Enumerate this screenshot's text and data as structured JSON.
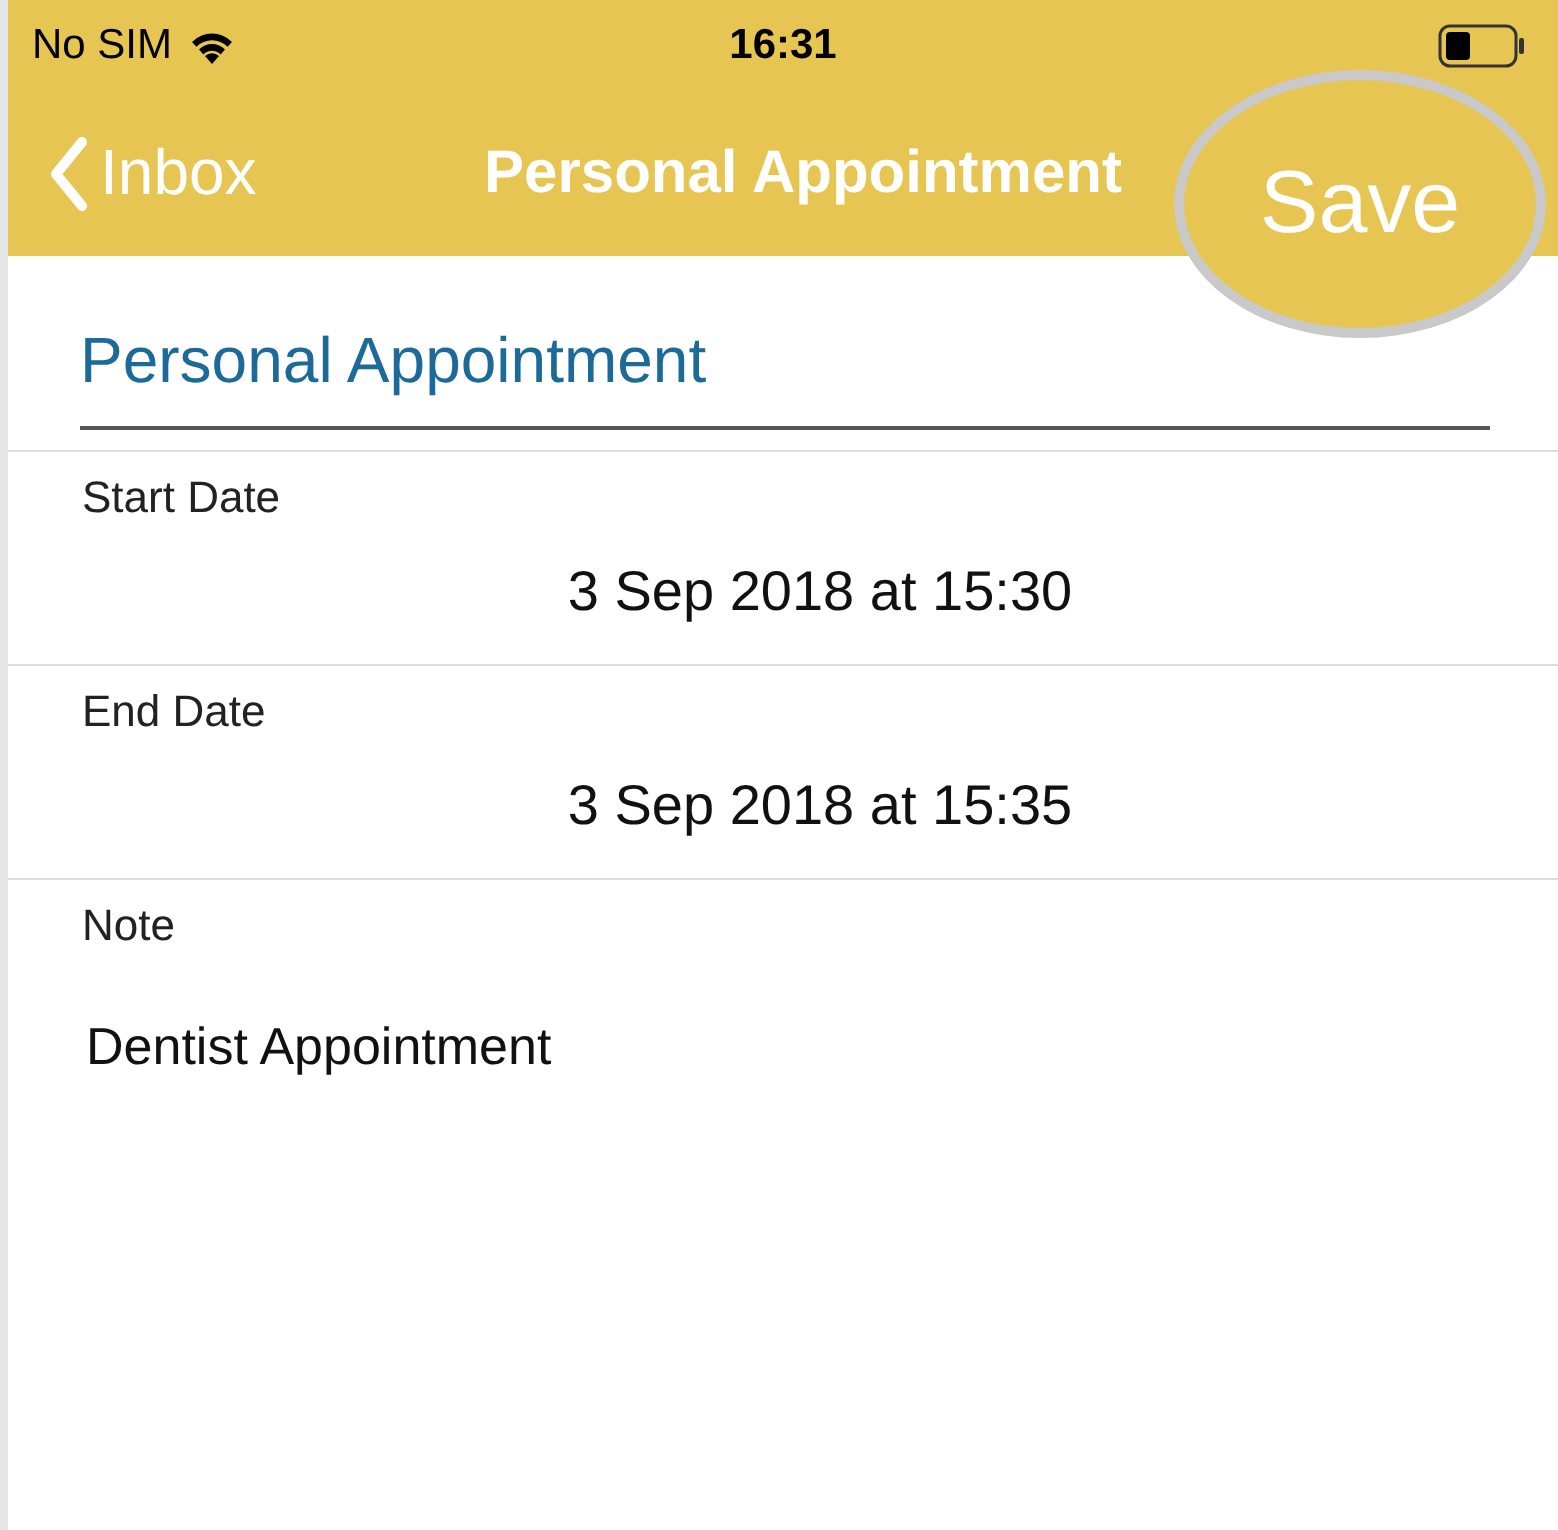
{
  "status_bar": {
    "carrier": "No SIM",
    "time": "16:31"
  },
  "nav_bar": {
    "back_label": "Inbox",
    "title": "Personal Appointment",
    "action": "Save",
    "action_highlighted": true
  },
  "title_field": {
    "value": "Personal Appointment"
  },
  "fields": [
    {
      "label": "Start Date",
      "value": "3 Sep 2018 at 15:30",
      "kind": "date"
    },
    {
      "label": "End Date",
      "value": "3 Sep 2018 at 15:35",
      "kind": "date"
    },
    {
      "label": "Note",
      "value": "Dentist Appointment",
      "kind": "note"
    }
  ]
}
